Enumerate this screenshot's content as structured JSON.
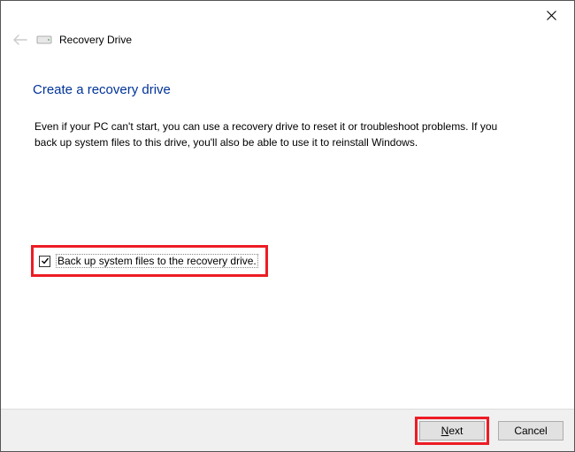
{
  "titlebar": {
    "close_tooltip": "Close"
  },
  "header": {
    "window_title": "Recovery Drive"
  },
  "content": {
    "heading": "Create a recovery drive",
    "description": "Even if your PC can't start, you can use a recovery drive to reset it or troubleshoot problems. If you back up system files to this drive, you'll also be able to use it to reinstall Windows."
  },
  "checkbox": {
    "checked": true,
    "label": "Back up system files to the recovery drive."
  },
  "footer": {
    "next_prefix": "N",
    "next_rest": "ext",
    "cancel_label": "Cancel"
  }
}
